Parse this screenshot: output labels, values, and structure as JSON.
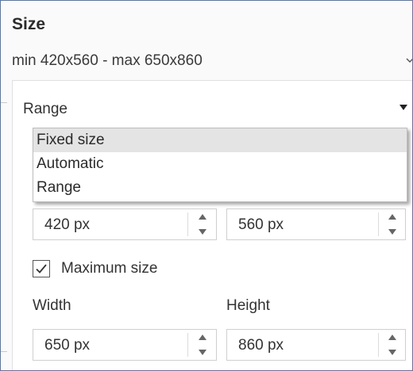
{
  "pane": {
    "title": "Size",
    "summary": "min 420x560 - max 650x860"
  },
  "mode": {
    "selected": "Range",
    "options": [
      "Fixed size",
      "Automatic",
      "Range"
    ],
    "highlighted": "Fixed size"
  },
  "min_size": {
    "width_value": "420 px",
    "height_value": "560 px"
  },
  "max_size": {
    "checkbox_label": "Maximum size",
    "checked": true,
    "width_label": "Width",
    "height_label": "Height",
    "width_value": "650 px",
    "height_value": "860 px"
  },
  "icons": {
    "summary_expand": "chevron-down-icon",
    "mode_dropdown": "caret-down-icon",
    "spin_up": "spin-up-icon",
    "spin_down": "spin-down-icon",
    "check": "checkmark-icon"
  },
  "colors": {
    "frame_border": "#4a78c2",
    "dropdown_selected_bg": "#e4e4e4"
  }
}
